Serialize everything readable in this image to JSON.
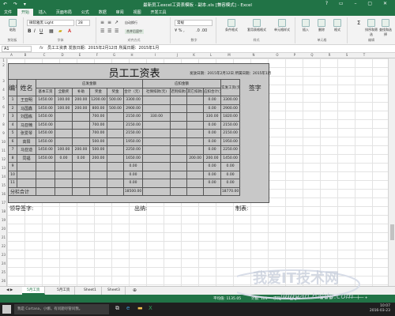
{
  "titlebar": {
    "title": "最新员工excel工资表模板 - 副本.xls [兼容模式] - Excel",
    "quick_access": "↶ ↷ ▾",
    "window_controls": "? ▭ – ▢ ✕"
  },
  "tabs": [
    "文件",
    "开始",
    "插入",
    "页面布局",
    "公式",
    "数据",
    "审阅",
    "视图",
    "开发工具"
  ],
  "ribbon": {
    "paste_label": "粘贴",
    "clipboard_group": "剪贴板",
    "font_name": "微软雅黑 Light",
    "font_size": "28",
    "font_group": "字体",
    "wrap_label": "自动换行",
    "merge_label": "合并后居中",
    "align_group": "对齐方式",
    "number_format": "常规",
    "number_group": "数字",
    "cond_format_label": "条件格式",
    "table_format_label": "套用表格格式",
    "cell_style_label": "单元格样式",
    "style_group": "样式",
    "insert_label": "插入",
    "delete_label": "删除",
    "format_label": "格式",
    "cells_group": "单元格",
    "sort_label": "排序和筛选",
    "find_label": "查找和选择",
    "edit_group": "编辑"
  },
  "formula_bar": {
    "cell_ref": "A1",
    "fx": "fx",
    "content": "员工工资表  发放日期：2015年2月12日  所属日期：2015年1月"
  },
  "columns": [
    "A",
    "B",
    "C",
    "D",
    "E",
    "F",
    "G",
    "H",
    "I",
    "J",
    "K",
    "L",
    "M",
    "N",
    "O",
    "P",
    "Q",
    "R",
    "S",
    "T",
    "U",
    "V",
    "W",
    "X"
  ],
  "rows": [
    "1",
    "2",
    "3",
    "4",
    "5",
    "6",
    "7",
    "8",
    "9",
    "10",
    "11",
    "12",
    "13",
    "14",
    "15",
    "16",
    "17",
    "18",
    "19",
    "20",
    "21",
    "22",
    "23",
    "24",
    "25",
    "26",
    "27"
  ],
  "sheet": {
    "title": "员工工资表",
    "issue_date": "发放日期：2015年2月12日 所属日期：2015年1月",
    "headers": {
      "no": "编号",
      "name": "姓名",
      "payable_group": "应发金额",
      "deduct_group": "应扣金额",
      "actual": "实发工资(元)",
      "sign": "签字",
      "basic": "基本工资",
      "allowance": "全勤奖",
      "subsidy": "补助",
      "overtime": "奖金",
      "bonus": "奖金",
      "total_payable": "合计（元）",
      "social": "社保扣款(元)",
      "late": "迟到扣款(元)",
      "other": "其它扣款(元)",
      "deduct_total": "应扣合计(元)"
    },
    "employees": [
      {
        "no": "1",
        "name": "王亚明",
        "basic": "1450.00",
        "allowance": "100.00",
        "subsidy": "200.00",
        "overtime": "1200.00",
        "bonus": "500.00",
        "total": "3300.00",
        "social": "",
        "late": "",
        "other": "",
        "deduct": "0.00",
        "actual": "3300.00"
      },
      {
        "no": "2",
        "name": "马国鑫",
        "basic": "1450.00",
        "allowance": "100.00",
        "subsidy": "200.00",
        "overtime": "800.00",
        "bonus": "500.00",
        "total": "2900.00",
        "social": "",
        "late": "",
        "other": "",
        "deduct": "0.00",
        "actual": "2900.00"
      },
      {
        "no": "3",
        "name": "刘国栋",
        "basic": "1450.00",
        "allowance": "",
        "subsidy": "",
        "overtime": "700.00",
        "bonus": "",
        "total": "2150.00",
        "social": "330.00",
        "late": "",
        "other": "",
        "deduct": "330.00",
        "actual": "1820.00"
      },
      {
        "no": "4",
        "name": "马亚楠",
        "basic": "1450.00",
        "allowance": "",
        "subsidy": "",
        "overtime": "700.00",
        "bonus": "",
        "total": "2150.00",
        "social": "",
        "late": "",
        "other": "",
        "deduct": "0.00",
        "actual": "2150.00"
      },
      {
        "no": "5",
        "name": "张爱琴",
        "basic": "1450.00",
        "allowance": "",
        "subsidy": "",
        "overtime": "700.00",
        "bonus": "",
        "total": "2150.00",
        "social": "",
        "late": "",
        "other": "",
        "deduct": "0.00",
        "actual": "2150.00"
      },
      {
        "no": "6",
        "name": "高阳",
        "basic": "1450.00",
        "allowance": "",
        "subsidy": "",
        "overtime": "500.00",
        "bonus": "",
        "total": "1950.00",
        "social": "",
        "late": "",
        "other": "",
        "deduct": "0.00",
        "actual": "1950.00"
      },
      {
        "no": "7",
        "name": "马亚迪",
        "basic": "1450.00",
        "allowance": "100.00",
        "subsidy": "200.00",
        "overtime": "500.00",
        "bonus": "",
        "total": "2250.00",
        "social": "",
        "late": "",
        "other": "",
        "deduct": "0.00",
        "actual": "2250.00"
      },
      {
        "no": "8",
        "name": "同福",
        "basic": "1450.00",
        "allowance": "0.00",
        "subsidy": "0.00",
        "overtime": "200.00",
        "bonus": "",
        "total": "1650.00",
        "social": "",
        "late": "",
        "other": "200.00",
        "deduct": "200.00",
        "actual": "1450.00"
      },
      {
        "no": "9",
        "name": "",
        "basic": "",
        "allowance": "",
        "subsidy": "",
        "overtime": "",
        "bonus": "",
        "total": "0.00",
        "social": "",
        "late": "",
        "other": "",
        "deduct": "0.00",
        "actual": "0.00"
      },
      {
        "no": "10",
        "name": "",
        "basic": "",
        "allowance": "",
        "subsidy": "",
        "overtime": "",
        "bonus": "",
        "total": "0.00",
        "social": "",
        "late": "",
        "other": "",
        "deduct": "0.00",
        "actual": "0.00"
      },
      {
        "no": "11",
        "name": "",
        "basic": "",
        "allowance": "",
        "subsidy": "",
        "overtime": "",
        "bonus": "",
        "total": "0.00",
        "social": "",
        "late": "",
        "other": "",
        "deduct": "0.00",
        "actual": "0.00"
      }
    ],
    "subtotal": {
      "label": "分栏合计",
      "total": "18500.00",
      "actual": "18770.00"
    },
    "footer": {
      "leader": "领导签字:",
      "cashier": "出纳:",
      "maker": "制表:"
    }
  },
  "sheet_tabs": [
    "5月工资",
    "5月工资",
    "Sheet1",
    "Sheet3"
  ],
  "status": {
    "avg": "平均值: 1135.05",
    "count": "计数: 101",
    "sum": "求和: 96566.00"
  },
  "taskbar": {
    "search": "我是 Cortana，小娜。有问题尽管问我。",
    "time": "10:07",
    "date": "2016-03-23"
  },
  "watermark": {
    "text": "我爱IT技术网",
    "url": "jingyan.baidu.com"
  },
  "colors": {
    "excel_green": "#217346",
    "sheet_gray": "#c8c8c8"
  }
}
